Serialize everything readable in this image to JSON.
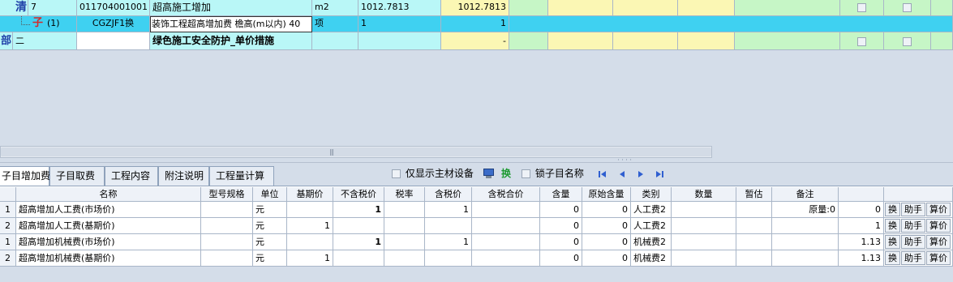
{
  "top_rows": [
    {
      "marker": "清",
      "seq": "7",
      "code": "011704001001",
      "name": "超高施工增加",
      "unit": "m2",
      "qty": "1012.7813",
      "total": "1012.7813"
    },
    {
      "marker": "子",
      "seq": "(1)",
      "code": "CGZJF1换",
      "name": "装饰工程超高增加费 檐高(m以内) 40",
      "unit": "项",
      "qty": "1",
      "total": "1"
    },
    {
      "marker": "部",
      "seq": "二",
      "code": "",
      "name": "绿色施工安全防护_单价措施",
      "unit": "",
      "qty": "",
      "total": "-"
    }
  ],
  "tabs": [
    "子目增加费",
    "子目取费",
    "工程内容",
    "附注说明",
    "工程量计算"
  ],
  "toolbar": {
    "main_material_label": "仅显示主材设备",
    "swap_label": "换",
    "lock_label": "锁子目名称"
  },
  "columns": [
    "名称",
    "型号规格",
    "单位",
    "基期价",
    "不含税价",
    "税率",
    "含税价",
    "含税合价",
    "含量",
    "原始含量",
    "类别",
    "数量",
    "暂估",
    "备注"
  ],
  "rows": [
    {
      "idx": "1",
      "name": "超高增加人工费(市场价)",
      "spec": "",
      "unit": "元",
      "base": "",
      "notax": "1",
      "rate": "",
      "tax": "1",
      "taxtotal": "",
      "content": "0",
      "orig": "0",
      "cat": "人工费2",
      "qty": "",
      "est": "",
      "note": "原量:0",
      "val": "0"
    },
    {
      "idx": "2",
      "name": "超高增加人工费(基期价)",
      "spec": "",
      "unit": "元",
      "base": "1",
      "notax": "",
      "rate": "",
      "tax": "",
      "taxtotal": "",
      "content": "0",
      "orig": "0",
      "cat": "人工费2",
      "qty": "",
      "est": "",
      "note": "",
      "val": "1"
    },
    {
      "idx": "1",
      "name": "超高增加机械费(市场价)",
      "spec": "",
      "unit": "元",
      "base": "",
      "notax": "1",
      "rate": "",
      "tax": "1",
      "taxtotal": "",
      "content": "0",
      "orig": "0",
      "cat": "机械费2",
      "qty": "",
      "est": "",
      "note": "",
      "val": "1.13"
    },
    {
      "idx": "2",
      "name": "超高增加机械费(基期价)",
      "spec": "",
      "unit": "元",
      "base": "1",
      "notax": "",
      "rate": "",
      "tax": "",
      "taxtotal": "",
      "content": "0",
      "orig": "0",
      "cat": "机械费2",
      "qty": "",
      "est": "",
      "note": "",
      "val": "1.13"
    }
  ],
  "row_actions": [
    "换",
    "助手",
    "算价"
  ]
}
